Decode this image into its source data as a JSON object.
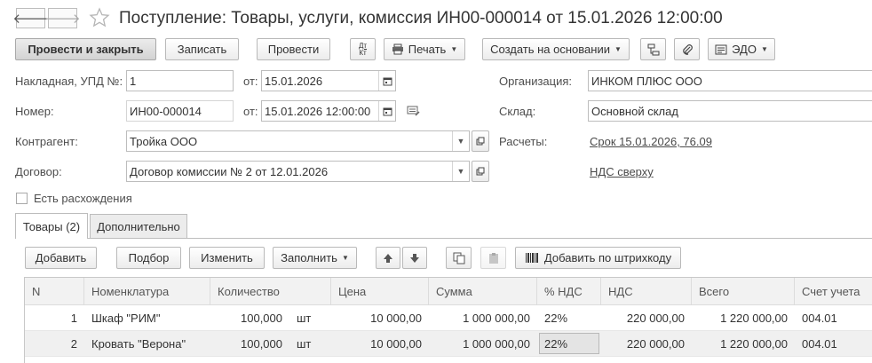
{
  "window": {
    "title": "Поступление: Товары, услуги, комиссия ИН00-000014 от 15.01.2026 12:00:00"
  },
  "toolbar": {
    "post_and_close": "Провести и закрыть",
    "save": "Записать",
    "post": "Провести",
    "dt_kt_top": "Дт",
    "dt_kt_bottom": "Кт",
    "print": "Печать",
    "create_based_on": "Создать на основании",
    "edo": "ЭДО"
  },
  "form": {
    "invoice_label": "Накладная, УПД №:",
    "invoice_value": "1",
    "from_label_1": "от:",
    "invoice_date": "15.01.2026",
    "number_label": "Номер:",
    "number_value": "ИН00-000014",
    "from_label_2": "от:",
    "number_datetime": "15.01.2026 12:00:00",
    "counterparty_label": "Контрагент:",
    "counterparty_value": "Тройка ООО",
    "contract_label": "Договор:",
    "contract_value": "Договор комиссии № 2 от 12.01.2026",
    "discrepancies_label": "Есть расхождения",
    "organization_label": "Организация:",
    "organization_value": "ИНКОМ ПЛЮС ООО",
    "warehouse_label": "Склад:",
    "warehouse_value": "Основной склад",
    "settlements_label": "Расчеты:",
    "settlements_link": "Срок 15.01.2026, 76.09",
    "vat_link": "НДС сверху"
  },
  "tabs": [
    {
      "label": "Товары (2)",
      "active": true
    },
    {
      "label": "Дополнительно",
      "active": false
    }
  ],
  "table_toolbar": {
    "add": "Добавить",
    "pick": "Подбор",
    "edit": "Изменить",
    "fill": "Заполнить",
    "add_by_barcode": "Добавить по штрихкоду"
  },
  "table": {
    "columns": [
      "N",
      "Номенклатура",
      "Количество",
      "Цена",
      "Сумма",
      "% НДС",
      "НДС",
      "Всего",
      "Счет учета"
    ],
    "rows": [
      {
        "n": "1",
        "name": "Шкаф \"РИМ\"",
        "qty": "100,000",
        "unit": "шт",
        "price": "10 000,00",
        "sum": "1 000 000,00",
        "vat_rate": "22%",
        "vat": "220 000,00",
        "total": "1 220 000,00",
        "account": "004.01"
      },
      {
        "n": "2",
        "name": "Кровать \"Верона\"",
        "qty": "100,000",
        "unit": "шт",
        "price": "10 000,00",
        "sum": "1 000 000,00",
        "vat_rate": "22%",
        "vat": "220 000,00",
        "total": "1 220 000,00",
        "account": "004.01"
      }
    ]
  }
}
